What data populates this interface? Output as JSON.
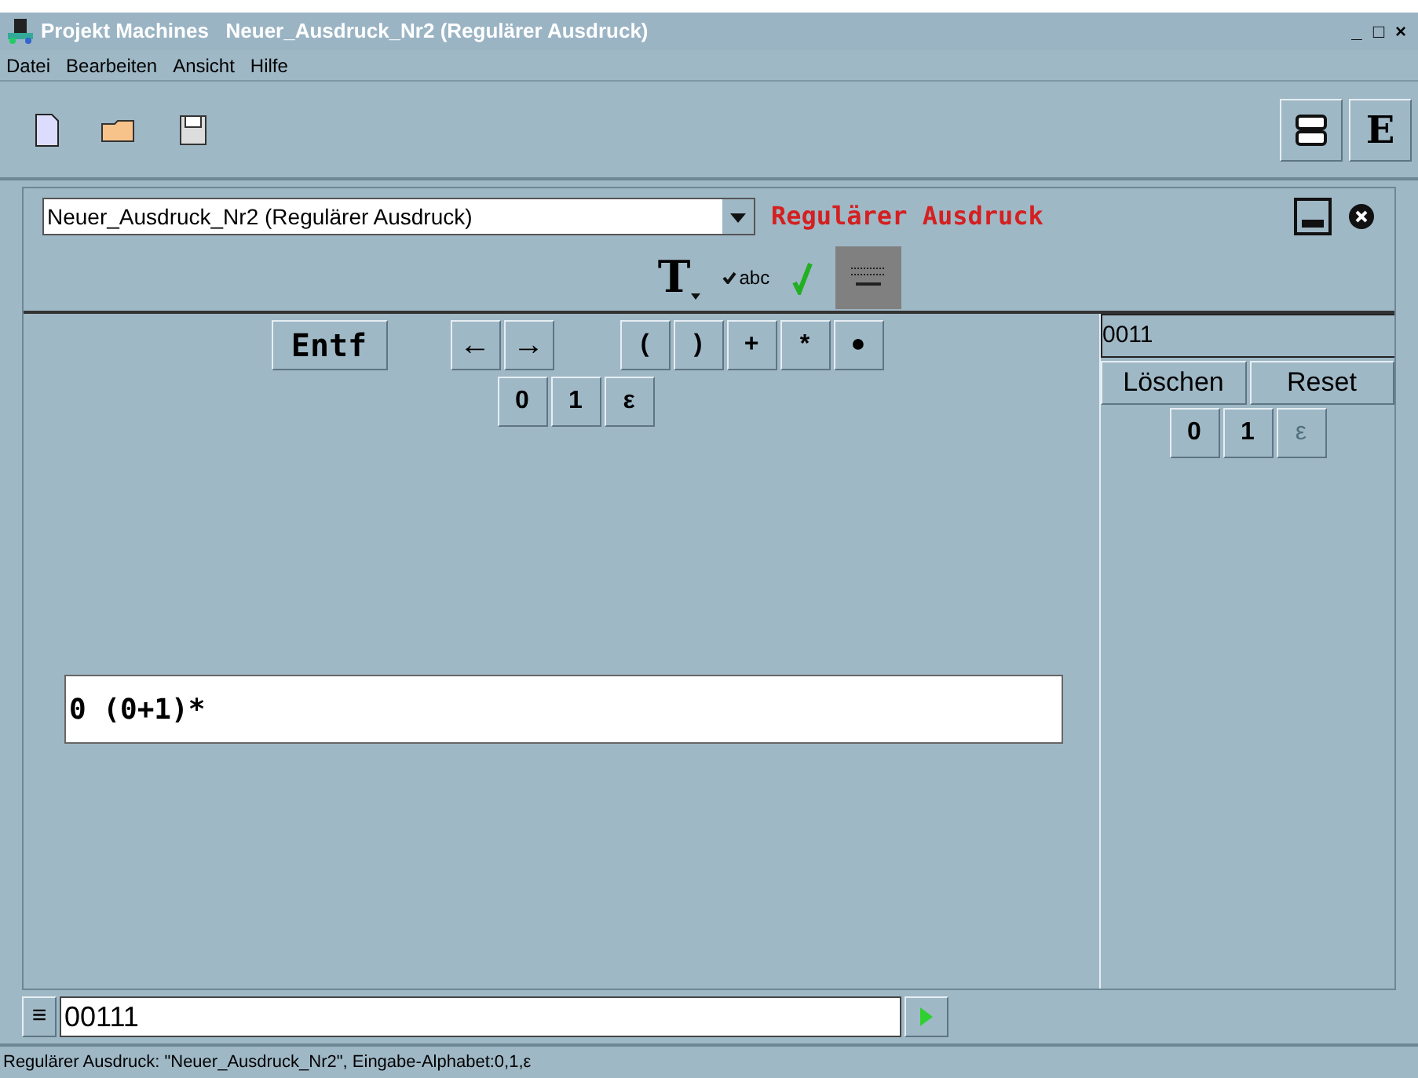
{
  "window": {
    "title": "Projekt Machines   Neuer_Ausdruck_Nr2 (Regulärer Ausdruck)",
    "controls": [
      "_",
      "□",
      "×"
    ]
  },
  "menu": [
    "Datei",
    "Bearbeiten",
    "Ansicht",
    "Hilfe"
  ],
  "toolbar": {
    "right_button": "E"
  },
  "editor": {
    "document_select": "Neuer_Ausdruck_Nr2 (Regulärer Ausdruck)",
    "type_label": "Regulärer Ausdruck",
    "format_tools": {
      "text_tool": "T",
      "spellcheck": "abc"
    },
    "keys_row1": [
      {
        "label": "Entf",
        "kind": "wide"
      },
      {
        "label": "←",
        "kind": "arrow"
      },
      {
        "label": "→",
        "kind": "arrow"
      },
      {
        "label": "(",
        "kind": "symbol"
      },
      {
        "label": ")",
        "kind": "symbol"
      },
      {
        "label": "+",
        "kind": "symbol"
      },
      {
        "label": "*",
        "kind": "symbol"
      },
      {
        "label": "●",
        "kind": "dot"
      }
    ],
    "keys_row2": [
      "0",
      "1",
      "ε"
    ],
    "expression": "0 (0+1)*"
  },
  "word_panel": {
    "value": "0011",
    "buttons": [
      "Löschen",
      "Reset"
    ],
    "keys": [
      {
        "label": "0",
        "disabled": false
      },
      {
        "label": "1",
        "disabled": false
      },
      {
        "label": "ε",
        "disabled": true
      }
    ]
  },
  "input_bar": {
    "menu_glyph": "≡",
    "value": "00111"
  },
  "status_bar": "Regulärer Ausdruck: \"Neuer_Ausdruck_Nr2\", Eingabe-Alphabet:0,1,ε"
}
